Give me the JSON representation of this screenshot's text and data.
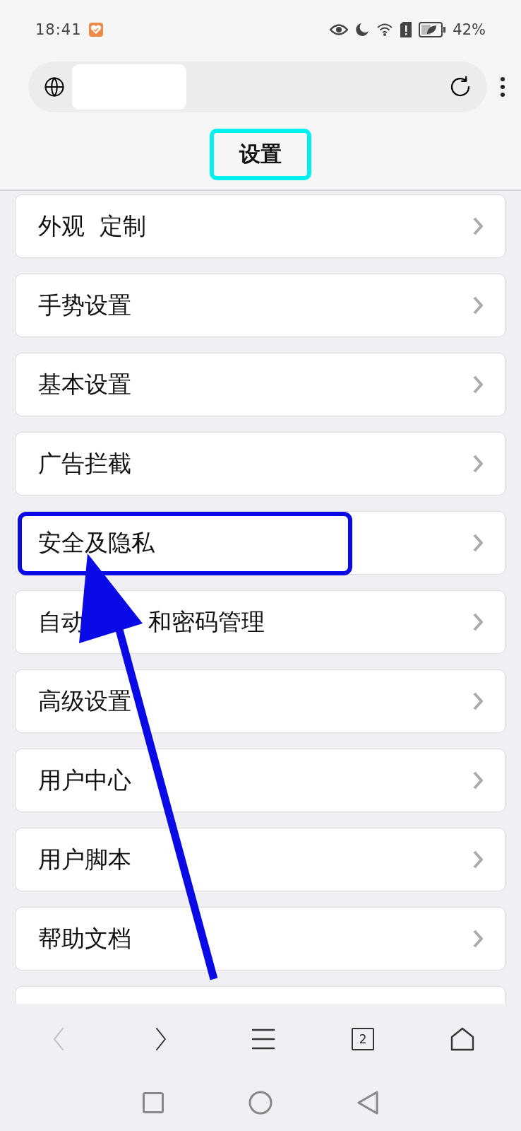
{
  "status_bar": {
    "time": "18:41",
    "battery": "42%"
  },
  "address_bar": {
    "redacted": true
  },
  "title": {
    "text": "设置",
    "highlighted": true
  },
  "items": [
    {
      "label_parts": [
        "外观  定制"
      ],
      "highlighted": false
    },
    {
      "label_parts": [
        "手势设置"
      ],
      "highlighted": false
    },
    {
      "label_parts": [
        "基本设置"
      ],
      "highlighted": false
    },
    {
      "label_parts": [
        "广告拦截"
      ],
      "highlighted": false
    },
    {
      "label_parts": [
        "安全及隐私"
      ],
      "highlighted": true
    },
    {
      "label_parts": [
        "自动",
        "和密码管理"
      ],
      "highlighted": false
    },
    {
      "label_parts": [
        "高级设置"
      ],
      "highlighted": false
    },
    {
      "label_parts": [
        "用户中心"
      ],
      "highlighted": false
    },
    {
      "label_parts": [
        "用户脚本"
      ],
      "highlighted": false
    },
    {
      "label_parts": [
        "帮助文档"
      ],
      "highlighted": false
    }
  ],
  "toolbar": {
    "back_disabled": true,
    "forward_disabled": false,
    "tab_count": "2"
  }
}
